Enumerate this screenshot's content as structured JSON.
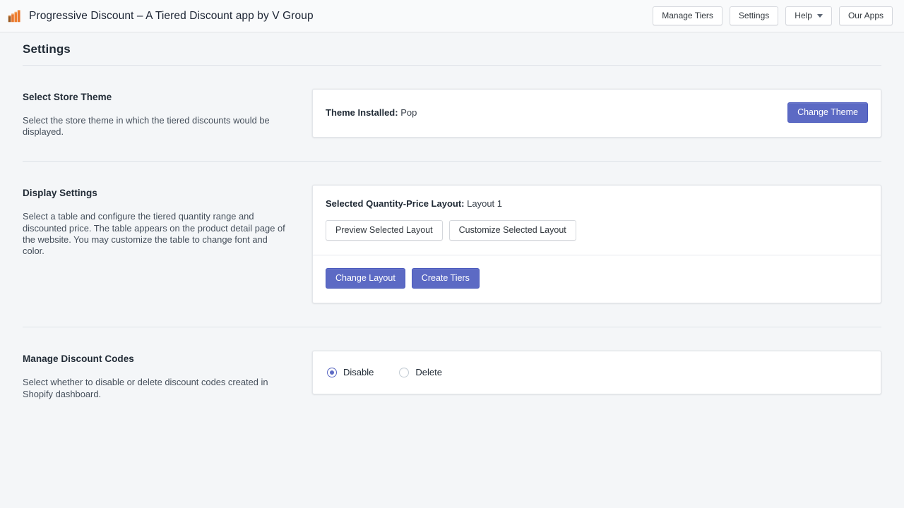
{
  "topbar": {
    "app_icon": "bar-chart-icon",
    "app_title": "Progressive Discount – A Tiered Discount app by V Group",
    "buttons": [
      {
        "label": "Manage Tiers",
        "icon": ""
      },
      {
        "label": "Settings",
        "icon": ""
      },
      {
        "label": "Help",
        "icon": "chevron-down-icon"
      },
      {
        "label": "Our Apps",
        "icon": ""
      }
    ]
  },
  "page": {
    "title": "Settings"
  },
  "sections": [
    {
      "heading": "Select Store Theme",
      "description": "Select the store theme in which the tiered discounts would be displayed.",
      "theme_label": "Theme Installed:",
      "theme_value": "Pop",
      "change_theme_label": "Change Theme"
    },
    {
      "heading": "Display Settings",
      "description": "Select a table and configure the tiered quantity range and discounted price. The table appears on the product detail page of the website. You may customize the table to change font and color.",
      "layout_label": "Selected Quantity-Price Layout:",
      "layout_value": "Layout 1",
      "preview_label": "Preview Selected Layout",
      "customize_label": "Customize Selected Layout",
      "change_layout_label": "Change Layout",
      "create_tiers_label": "Create Tiers"
    },
    {
      "heading": "Manage Discount Codes",
      "description": "Select whether to disable or delete discount codes created in Shopify dashboard.",
      "options": [
        {
          "label": "Disable",
          "selected": true
        },
        {
          "label": "Delete",
          "selected": false
        }
      ]
    }
  ],
  "colors": {
    "accent": "#5c6ac4",
    "page_bg": "#f4f6f8",
    "card_bg": "#ffffff",
    "text": "#212b36",
    "icon_orange": "#e8762c"
  }
}
